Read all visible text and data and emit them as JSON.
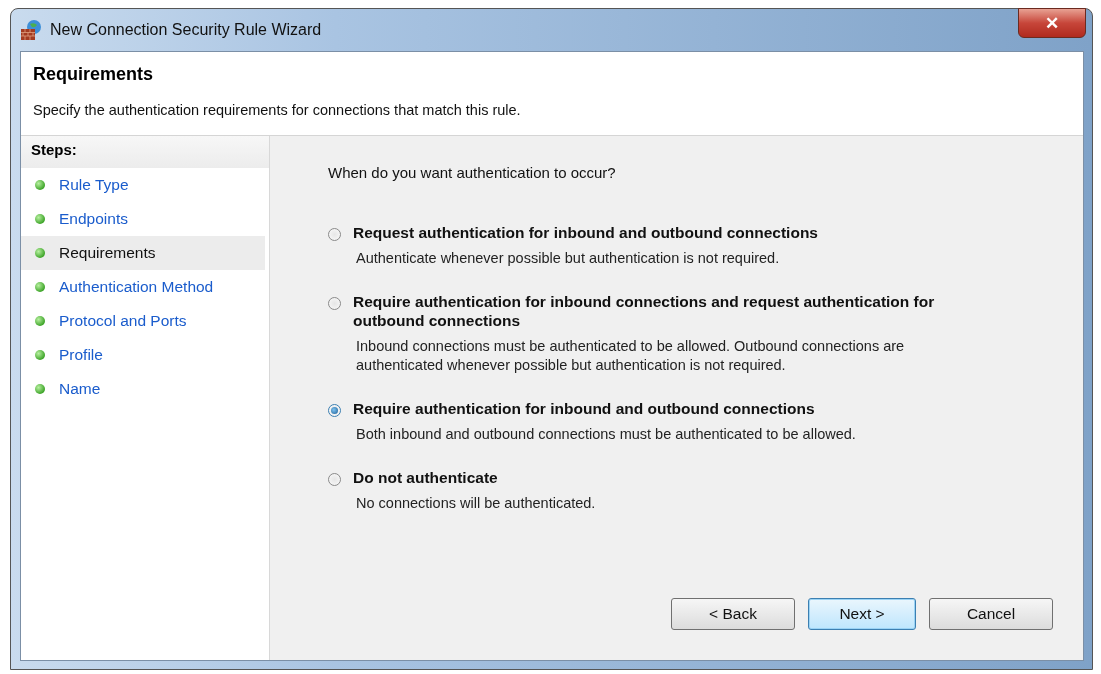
{
  "window": {
    "title": "New Connection Security Rule Wizard",
    "close_label": "✕"
  },
  "header": {
    "title": "Requirements",
    "description": "Specify the authentication requirements for connections that match this rule."
  },
  "steps": {
    "heading": "Steps:",
    "items": [
      {
        "label": "Rule Type",
        "selected": false
      },
      {
        "label": "Endpoints",
        "selected": false
      },
      {
        "label": "Requirements",
        "selected": true
      },
      {
        "label": "Authentication Method",
        "selected": false
      },
      {
        "label": "Protocol and Ports",
        "selected": false
      },
      {
        "label": "Profile",
        "selected": false
      },
      {
        "label": "Name",
        "selected": false
      }
    ]
  },
  "question": "When do you want authentication to occur?",
  "options": [
    {
      "label": "Request authentication for inbound and outbound connections",
      "description": "Authenticate whenever possible but authentication is not required.",
      "selected": false
    },
    {
      "label": "Require authentication for inbound connections and request authentication for outbound connections",
      "description": "Inbound connections must be authenticated to be allowed. Outbound connections are authenticated whenever possible but authentication is not required.",
      "selected": false
    },
    {
      "label": "Require authentication for inbound and outbound connections",
      "description": "Both inbound and outbound connections must be authenticated to be allowed.",
      "selected": true
    },
    {
      "label": "Do not authenticate",
      "description": "No connections will be authenticated.",
      "selected": false
    }
  ],
  "buttons": [
    {
      "label": "< Back",
      "default": false
    },
    {
      "label": "Next >",
      "default": true
    },
    {
      "label": "Cancel",
      "default": false
    }
  ]
}
